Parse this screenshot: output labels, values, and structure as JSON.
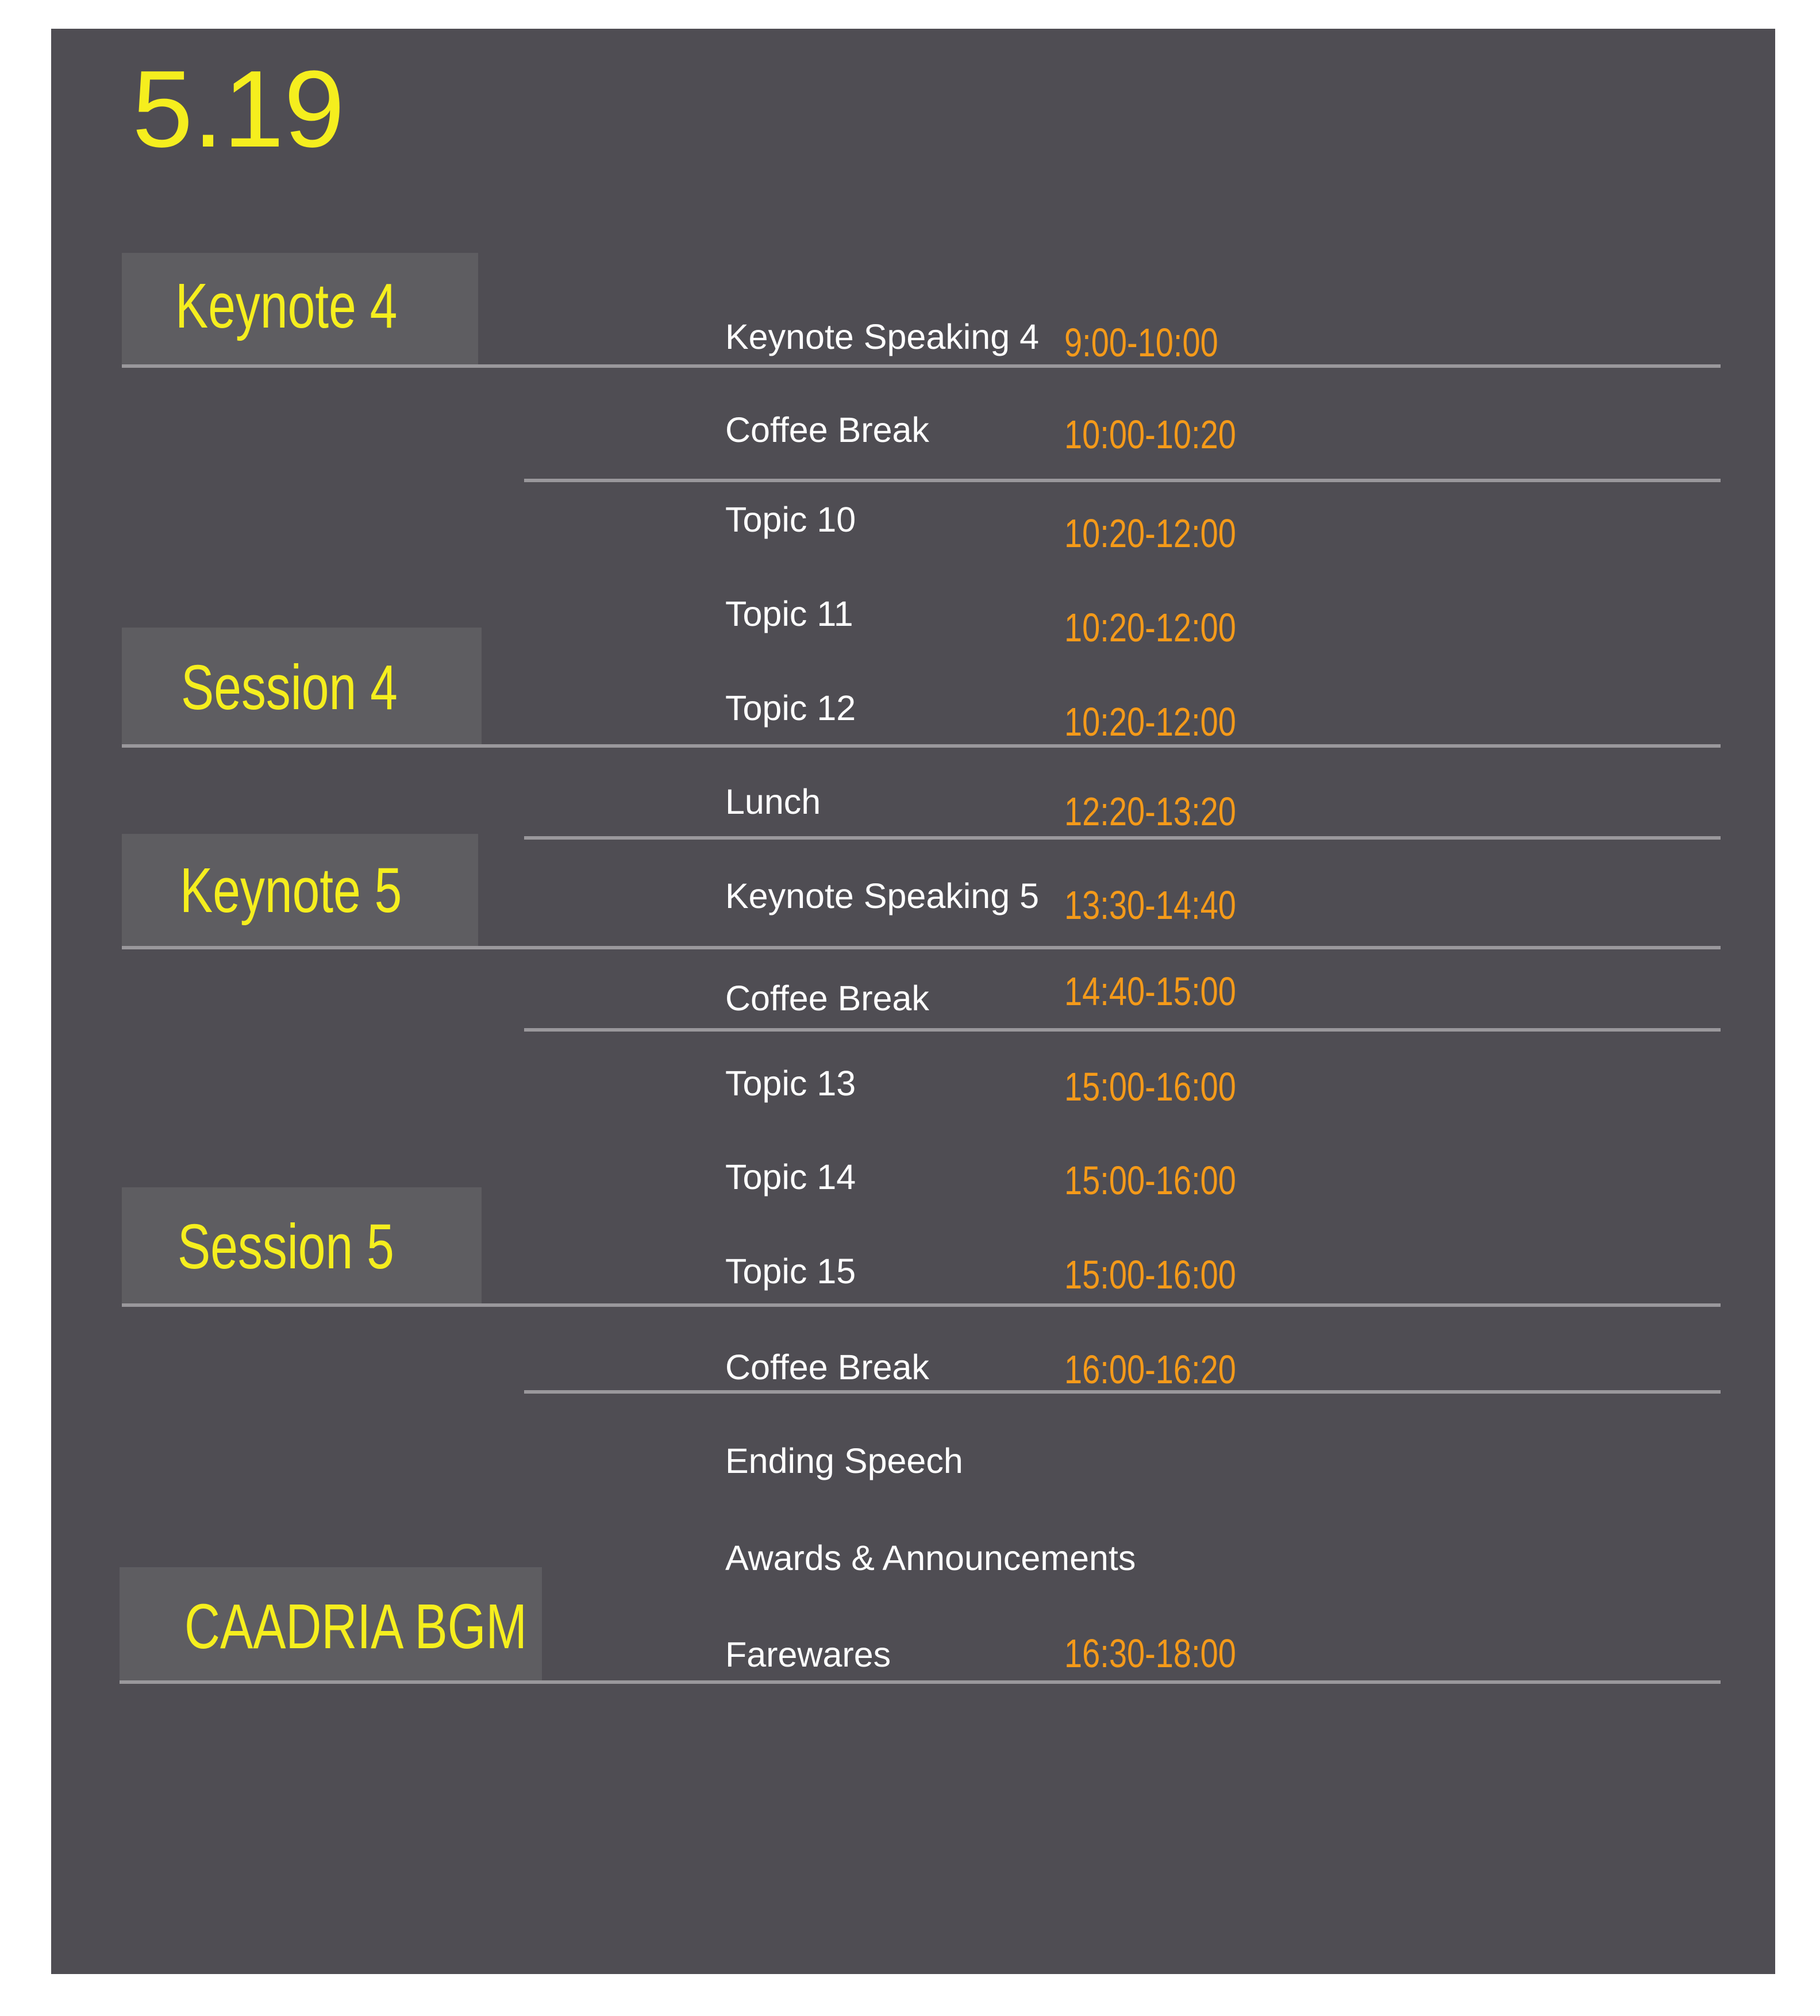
{
  "date": "5.19",
  "colors": {
    "panel_background": "#4f4d53",
    "label_box": "#5e5d61",
    "heading_yellow": "#f5ee1e",
    "time_orange": "#f49a1a",
    "event_text": "#ffffff",
    "rule": "#9a989c"
  },
  "sections": [
    {
      "label": "Keynote 4"
    },
    {
      "label": "Session 4"
    },
    {
      "label": "Keynote 5"
    },
    {
      "label": "Session 5"
    },
    {
      "label": "CAADRIA BGM"
    }
  ],
  "events": [
    {
      "title": "Keynote Speaking 4",
      "time": "9:00-10:00"
    },
    {
      "title": "Coffee Break",
      "time": "10:00-10:20"
    },
    {
      "title": "Topic 10",
      "time": "10:20-12:00"
    },
    {
      "title": "Topic 11",
      "time": "10:20-12:00"
    },
    {
      "title": "Topic 12",
      "time": "10:20-12:00"
    },
    {
      "title": "Lunch",
      "time": "12:20-13:20"
    },
    {
      "title": "Keynote Speaking 5",
      "time": "13:30-14:40"
    },
    {
      "title": "Coffee Break",
      "time": "14:40-15:00"
    },
    {
      "title": "Topic 13",
      "time": "15:00-16:00"
    },
    {
      "title": "Topic 14",
      "time": "15:00-16:00"
    },
    {
      "title": "Topic 15",
      "time": "15:00-16:00"
    },
    {
      "title": "Coffee Break",
      "time": "16:00-16:20"
    },
    {
      "title": "Ending Speech",
      "time": ""
    },
    {
      "title": "Awards & Announcements",
      "time": ""
    },
    {
      "title": "Farewares",
      "time": "16:30-18:00"
    }
  ]
}
